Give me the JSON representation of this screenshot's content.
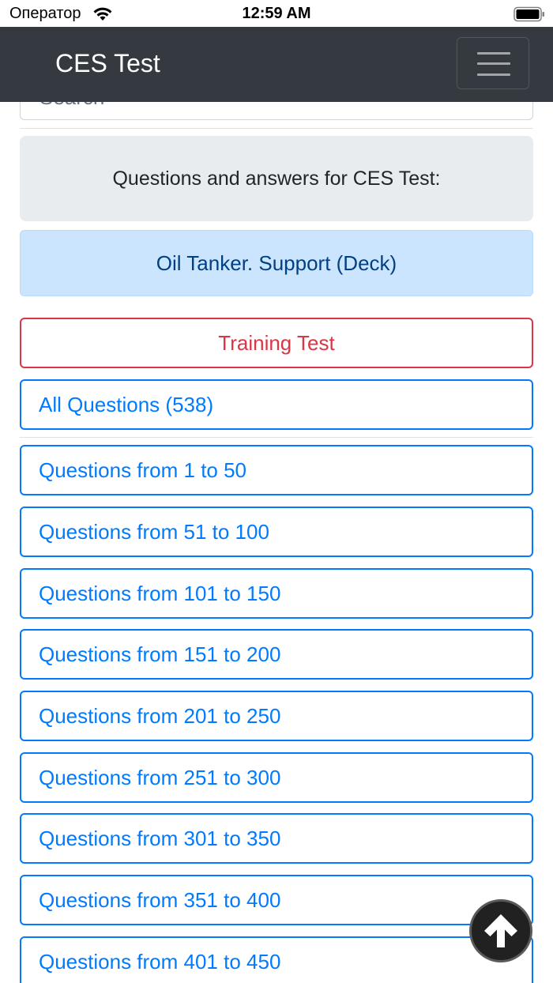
{
  "status_bar": {
    "carrier": "Оператор",
    "time": "12:59 AM",
    "icons": [
      "wifi-icon",
      "battery-icon"
    ]
  },
  "navbar": {
    "brand": "CES Test",
    "toggler_icon": "hamburger-menu-icon"
  },
  "search": {
    "placeholder": "Search"
  },
  "heading": "Questions and answers for CES Test:",
  "category": "Oil Tanker. Support (Deck)",
  "training_button": "Training Test",
  "all_questions_button": "All Questions (538)",
  "ranges": [
    "Questions from 1 to 50",
    "Questions from 51 to 100",
    "Questions from 101 to 150",
    "Questions from 151 to 200",
    "Questions from 201 to 250",
    "Questions from 251 to 300",
    "Questions from 301 to 350",
    "Questions from 351 to 400",
    "Questions from 401 to 450"
  ],
  "scroll_top_icon": "arrow-up-icon",
  "colors": {
    "navbar": "#343a40",
    "primary": "#007bff",
    "danger": "#dc3545",
    "alert_bg": "#cce5ff",
    "jumbotron_bg": "#e9ecef"
  }
}
